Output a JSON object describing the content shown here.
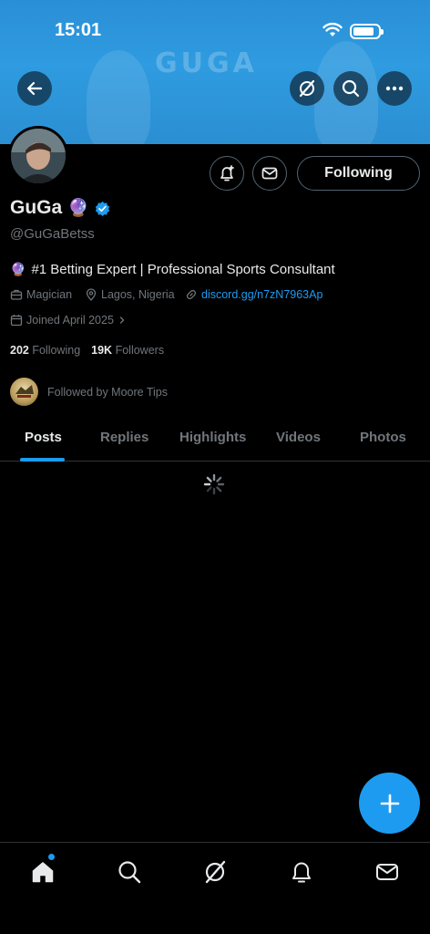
{
  "status_bar": {
    "time": "15:01"
  },
  "banner": {
    "text": "GUGA"
  },
  "header": {
    "back_icon": "arrow-left-icon",
    "grok_icon": "grok-icon",
    "search_icon": "search-icon",
    "more_icon": "more-icon"
  },
  "profile": {
    "name": "GuGa",
    "name_emoji": "🔮",
    "handle": "@GuGaBetss",
    "bio_emoji": "🔮",
    "bio": "#1 Betting Expert | Professional Sports Consultant",
    "category": "Magician",
    "location": "Lagos, Nigeria",
    "website": "discord.gg/n7zN7963Ap",
    "joined": "Joined April 2025",
    "following_count": "202",
    "following_label": "Following",
    "followers_count": "19K",
    "followers_label": "Followers",
    "followed_by": "Followed by Moore Tips",
    "follow_button": "Following"
  },
  "tabs": [
    "Posts",
    "Replies",
    "Highlights",
    "Videos",
    "Photos"
  ],
  "active_tab": "Posts",
  "colors": {
    "accent": "#1d9bf0",
    "background": "#000000",
    "muted": "#71767b"
  },
  "bottom_nav": [
    "home-icon",
    "search-icon",
    "grok-icon",
    "notifications-icon",
    "messages-icon"
  ]
}
